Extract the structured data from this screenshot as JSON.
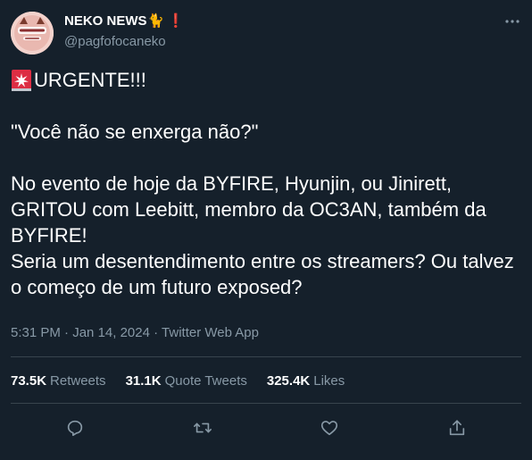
{
  "author": {
    "name": "NEKO NEWS",
    "badge_emoji": "🐈",
    "badge_mark": "❗",
    "handle": "@pagfofocaneko",
    "avatar": "neko-news-logo"
  },
  "tweet": {
    "siren_icon": "rotating-light-icon",
    "headline": "URGENTE!!!",
    "quote": "\"Você não se enxerga não?\"",
    "paragraph_1": "No evento de hoje da BYFIRE, Hyunjin, ou Jinirett, GRITOU com Leebitt, membro da OC3AN, também da BYFIRE!",
    "paragraph_2": "Seria um desentendimento entre os streamers? Ou talvez o começo de um futuro exposed?"
  },
  "meta": {
    "time": "5:31 PM",
    "separator_1": "·",
    "date": "Jan 14, 2024",
    "separator_2": "·",
    "source": "Twitter Web App"
  },
  "stats": {
    "retweets_count": "73.5K",
    "retweets_label": "Retweets",
    "quotes_count": "31.1K",
    "quotes_label": "Quote Tweets",
    "likes_count": "325.4K",
    "likes_label": "Likes"
  },
  "actions": {
    "reply": "reply-icon",
    "retweet": "retweet-icon",
    "like": "heart-icon",
    "share": "share-icon"
  },
  "colors": {
    "background": "#15202b",
    "text": "#ffffff",
    "muted": "#8899a6",
    "divider": "#38444d",
    "badge_red": "#e0245e"
  }
}
